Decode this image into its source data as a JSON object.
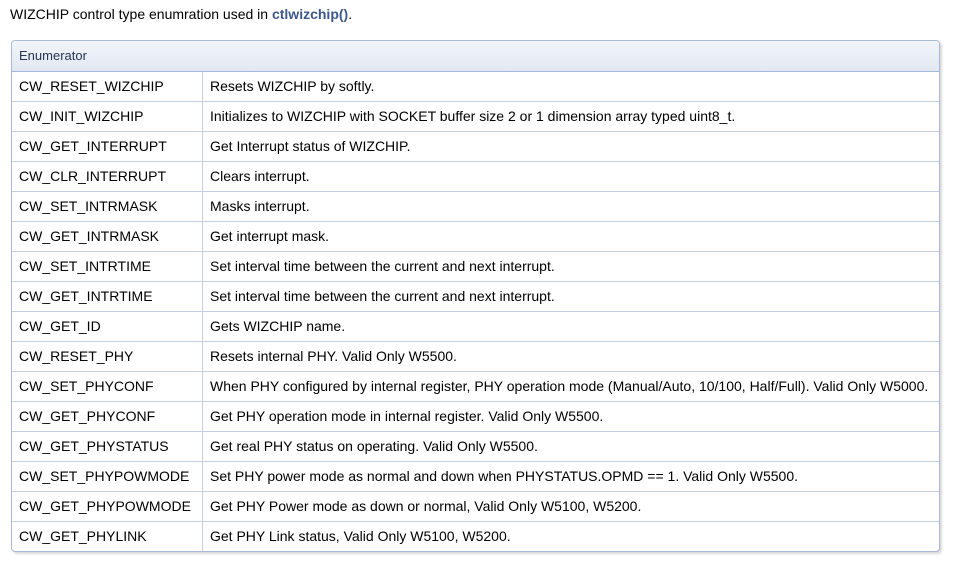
{
  "intro": {
    "text": "WIZCHIP control type enumration used in ",
    "link": "ctlwizchip()",
    "suffix": "."
  },
  "table": {
    "header": "Enumerator",
    "rows": [
      {
        "name": "CW_RESET_WIZCHIP",
        "desc": "Resets WIZCHIP by softly."
      },
      {
        "name": "CW_INIT_WIZCHIP",
        "desc": "Initializes to WIZCHIP with SOCKET buffer size 2 or 1 dimension array typed uint8_t."
      },
      {
        "name": "CW_GET_INTERRUPT",
        "desc": "Get Interrupt status of WIZCHIP."
      },
      {
        "name": "CW_CLR_INTERRUPT",
        "desc": "Clears interrupt."
      },
      {
        "name": "CW_SET_INTRMASK",
        "desc": "Masks interrupt."
      },
      {
        "name": "CW_GET_INTRMASK",
        "desc": "Get interrupt mask."
      },
      {
        "name": "CW_SET_INTRTIME",
        "desc": "Set interval time between the current and next interrupt."
      },
      {
        "name": "CW_GET_INTRTIME",
        "desc": "Set interval time between the current and next interrupt."
      },
      {
        "name": "CW_GET_ID",
        "desc": "Gets WIZCHIP name."
      },
      {
        "name": "CW_RESET_PHY",
        "desc": "Resets internal PHY. Valid Only W5500."
      },
      {
        "name": "CW_SET_PHYCONF",
        "desc": "When PHY configured by internal register, PHY operation mode (Manual/Auto, 10/100, Half/Full). Valid Only W5000."
      },
      {
        "name": "CW_GET_PHYCONF",
        "desc": "Get PHY operation mode in internal register. Valid Only W5500."
      },
      {
        "name": "CW_GET_PHYSTATUS",
        "desc": "Get real PHY status on operating. Valid Only W5500."
      },
      {
        "name": "CW_SET_PHYPOWMODE",
        "desc": "Set PHY power mode as normal and down when PHYSTATUS.OPMD == 1. Valid Only W5500."
      },
      {
        "name": "CW_GET_PHYPOWMODE",
        "desc": "Get PHY Power mode as down or normal, Valid Only W5100, W5200."
      },
      {
        "name": "CW_GET_PHYLINK",
        "desc": "Get PHY Link status, Valid Only W5100, W5200."
      }
    ]
  }
}
